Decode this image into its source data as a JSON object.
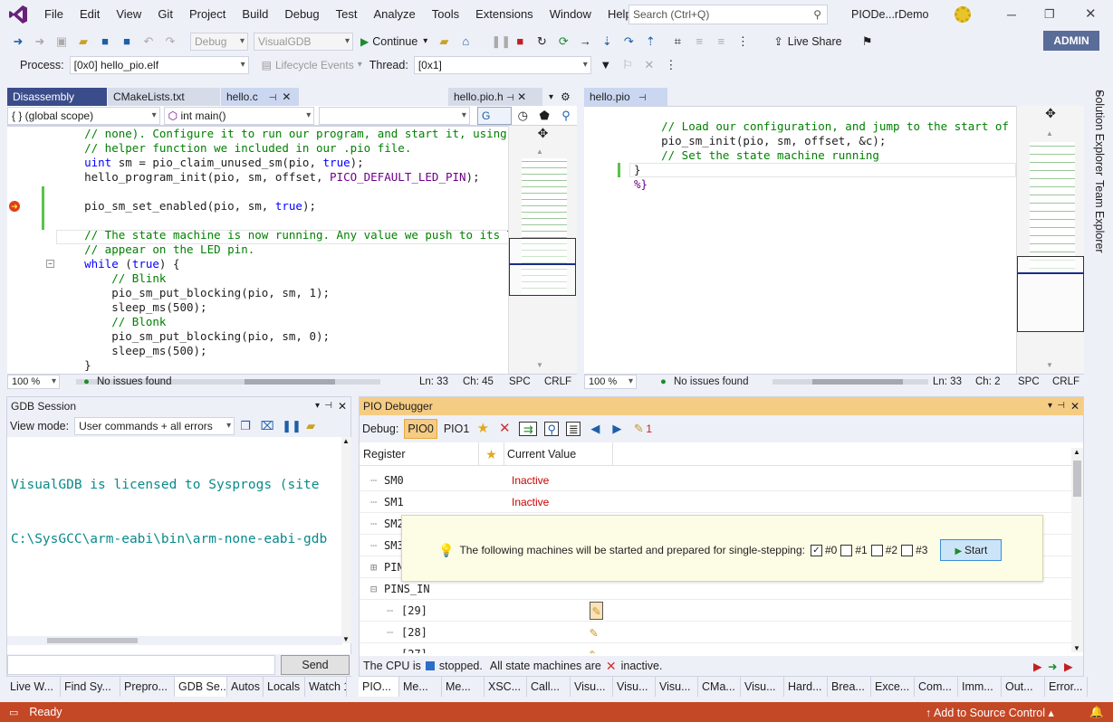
{
  "menu": {
    "items": [
      "File",
      "Edit",
      "View",
      "Git",
      "Project",
      "Build",
      "Debug",
      "Test",
      "Analyze",
      "Tools",
      "Extensions",
      "Window",
      "Help"
    ],
    "search_placeholder": "Search (Ctrl+Q)",
    "solution_name": "PIODe...rDemo",
    "user": "ADMIN"
  },
  "toolbar": {
    "config": "Debug",
    "platform": "VisualGDB",
    "continue": "Continue",
    "live_share": "Live Share"
  },
  "toolbar2": {
    "process_label": "Process:",
    "process_value": "[0x0] hello_pio.elf",
    "lifecycle": "Lifecycle Events",
    "thread_label": "Thread:",
    "thread_value": "[0x1]"
  },
  "left_editor": {
    "tabs": [
      "Disassembly",
      "CMakeLists.txt",
      "hello.c",
      "hello.pio.h"
    ],
    "scope": "{ } (global scope)",
    "func": "int main()",
    "go": "Go",
    "lines": [
      "    // none). Configure it to run our program, and start it, using the",
      "    // helper function we included in our .pio file.",
      "    uint sm = pio_claim_unused_sm(pio, true);",
      "    hello_program_init(pio, sm, offset, PICO_DEFAULT_LED_PIN);",
      "",
      "    pio_sm_set_enabled(pio, sm, true);",
      "",
      "    // The state machine is now running. Any value we push to its TX FI",
      "    // appear on the LED pin.",
      "    while (true) {",
      "        // Blink",
      "        pio_sm_put_blocking(pio, sm, 1);",
      "        sleep_ms(500);",
      "        // Blonk",
      "        pio_sm_put_blocking(pio, sm, 0);",
      "        sleep_ms(500);",
      "    }"
    ],
    "zoom": "100 %",
    "issues": "No issues found",
    "ln": "Ln: 33",
    "ch": "Ch: 45",
    "spc": "SPC",
    "eol": "CRLF"
  },
  "right_editor": {
    "tab": "hello.pio",
    "lines": [
      "    // Load our configuration, and jump to the start of the p",
      "    pio_sm_init(pio, sm, offset, &c);",
      "    // Set the state machine running",
      "}",
      "%}"
    ],
    "zoom": "100 %",
    "issues": "No issues found",
    "ln": "Ln: 33",
    "ch": "Ch: 2",
    "spc": "SPC",
    "eol": "CRLF"
  },
  "side_tabs": [
    "Solution Explorer",
    "Team Explorer"
  ],
  "gdb": {
    "title": "GDB Session",
    "view_mode_label": "View mode:",
    "view_mode": "User commands + all errors",
    "output": [
      "VisualGDB is licensed to Sysprogs (site",
      "C:\\SysGCC\\arm-eabi\\bin\\arm-none-eabi-gdb"
    ],
    "send": "Send"
  },
  "pio": {
    "title": "PIO Debugger",
    "debug_label": "Debug:",
    "pio0": "PIO0",
    "pio1": "PIO1",
    "badge": "1",
    "col_register": "Register",
    "col_value": "Current Value",
    "rows": [
      {
        "name": "SM0",
        "value": "Inactive"
      },
      {
        "name": "SM1",
        "value": "Inactive"
      },
      {
        "name": "SM2",
        "value": ""
      },
      {
        "name": "SM3",
        "value": ""
      },
      {
        "name": "PINS",
        "value": ""
      },
      {
        "name": "PINS_IN",
        "value": ""
      },
      {
        "name": "[29]",
        "value": ""
      },
      {
        "name": "[28]",
        "value": ""
      },
      {
        "name": "[27]",
        "value": ""
      }
    ],
    "popup_text": "The following machines will be started and prepared for single-stepping:",
    "checks": [
      "#0",
      "#1",
      "#2",
      "#3"
    ],
    "start": "Start",
    "status_a": "The CPU is",
    "status_b": "stopped.",
    "status_c": "All state machines are",
    "status_d": "inactive."
  },
  "bottom_tabs_left": [
    "Live W...",
    "Find Sy...",
    "Prepro...",
    "GDB Se...",
    "Autos",
    "Locals",
    "Watch 1"
  ],
  "bottom_tabs_right": [
    "PIO...",
    "Me...",
    "Me...",
    "XSC...",
    "Call...",
    "Visu...",
    "Visu...",
    "Visu...",
    "CMa...",
    "Visu...",
    "Hard...",
    "Brea...",
    "Exce...",
    "Com...",
    "Imm...",
    "Out...",
    "Error..."
  ],
  "status": {
    "ready": "Ready",
    "source_control": "Add to Source Control"
  },
  "colors": {
    "accent": "#5a3aaa",
    "statusbar": "#c44826",
    "inactive": "#cc0000"
  }
}
